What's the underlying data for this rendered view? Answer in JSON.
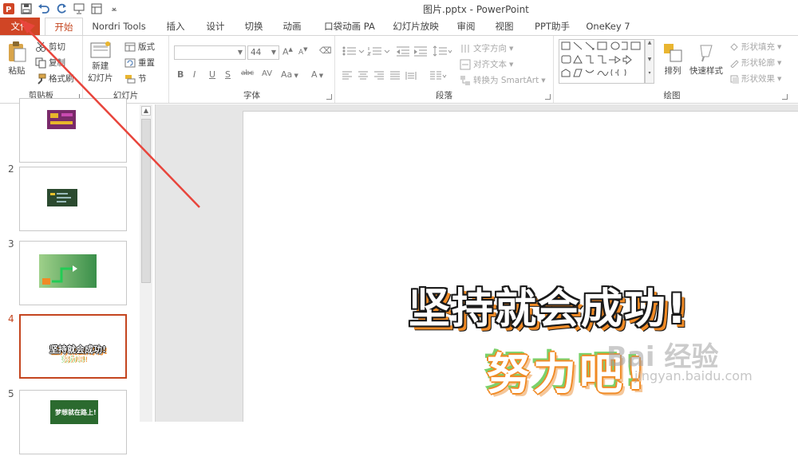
{
  "window": {
    "title": "图片.pptx - PowerPoint"
  },
  "qat": {
    "items": [
      {
        "name": "ppt-logo-icon"
      },
      {
        "name": "save-icon"
      },
      {
        "name": "undo-icon"
      },
      {
        "name": "redo-icon"
      },
      {
        "name": "slideshow-icon"
      },
      {
        "name": "layout-icon"
      },
      {
        "name": "customize-qat-icon"
      }
    ]
  },
  "tabs": [
    {
      "label": "文件"
    },
    {
      "label": "开始"
    },
    {
      "label": "Nordri Tools"
    },
    {
      "label": "插入"
    },
    {
      "label": "设计"
    },
    {
      "label": "切换"
    },
    {
      "label": "动画"
    },
    {
      "label": "口袋动画 PA"
    },
    {
      "label": "幻灯片放映"
    },
    {
      "label": "审阅"
    },
    {
      "label": "视图"
    },
    {
      "label": "PPT助手"
    },
    {
      "label": "OneKey 7"
    }
  ],
  "ribbon": {
    "clipboard": {
      "label": "剪贴板",
      "paste": "粘贴",
      "cut": "剪切",
      "copy": "复制",
      "format_painter": "格式刷"
    },
    "slides": {
      "label": "幻灯片",
      "new_slide_line1": "新建",
      "new_slide_line2": "幻灯片",
      "layout": "版式",
      "reset": "重置",
      "section": "节"
    },
    "font": {
      "label": "字体",
      "font_name": "",
      "font_size": "44",
      "bold": "B",
      "italic": "I",
      "underline": "U",
      "strike": "S",
      "char_spacing": "abc",
      "change_case": "Aa",
      "font_color": "A",
      "grow": "A",
      "shrink": "A"
    },
    "paragraph": {
      "label": "段落",
      "text_direction": "文字方向",
      "align_text": "对齐文本",
      "convert_smartart": "转换为 SmartArt"
    },
    "drawing": {
      "label": "绘图",
      "arrange": "排列",
      "quick_styles": "快速样式",
      "shape_fill": "形状填充",
      "shape_outline": "形状轮廓",
      "shape_effects": "形状效果"
    }
  },
  "thumbnails": [
    {
      "number": "",
      "selected": false
    },
    {
      "number": "2",
      "selected": false
    },
    {
      "number": "3",
      "selected": false
    },
    {
      "number": "4",
      "selected": true
    },
    {
      "number": "5",
      "selected": false
    }
  ],
  "thumb_texts": {
    "thumb4_line1": "坚持就会成功!",
    "thumb4_line2": "努力吧!",
    "thumb5_text": "梦想就在路上!"
  },
  "slide": {
    "headline": "坚持就会成功!",
    "subline": "努力吧!"
  },
  "watermark": {
    "text": "Bai  经验",
    "sub": "jingyan.baidu.com"
  },
  "colors": {
    "accent": "#c4451f",
    "file_tab": "#d04525",
    "arrow": "#e8453c",
    "headline_shadow": "#f08a25",
    "subline_green": "#7bd16a"
  }
}
